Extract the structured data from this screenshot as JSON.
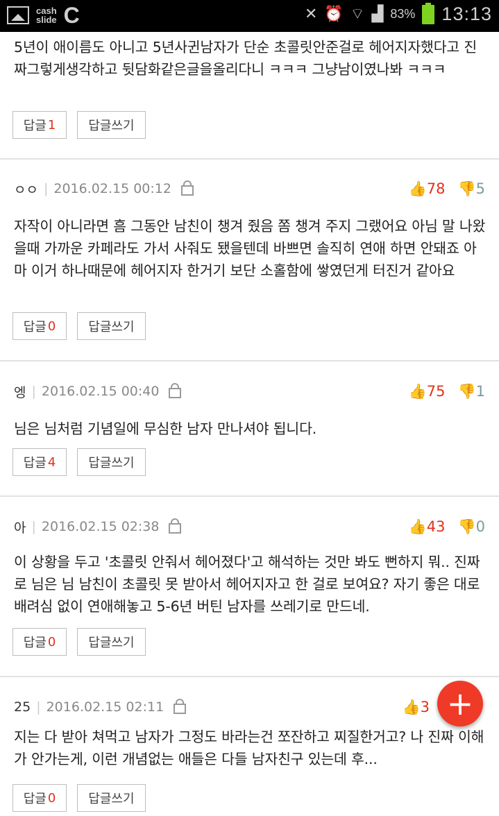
{
  "status_bar": {
    "app_brand_top": "cash",
    "app_brand_bottom": "slide",
    "app_letter": "C",
    "battery_pct": "83%",
    "time": "13:13",
    "icons": [
      "image-icon",
      "mute-icon",
      "alarm-icon",
      "wifi-icon",
      "signal-icon",
      "battery-icon"
    ]
  },
  "comments": [
    {
      "body": "5년이 애이름도 아니고 5년사귄남자가 단순 초콜릿안준걸로 헤어지자했다고 진짜그렇게생각하고 뒷담화같은글을올리다니 ㅋㅋㅋ 그냥남이였나봐 ㅋㅋㅋ",
      "reply_label": "답글",
      "reply_count": "1",
      "write_label": "답글쓰기"
    },
    {
      "author": "ㅇㅇ",
      "date": "2016.02.15 00:12",
      "up": "78",
      "down": "5",
      "body": "자작이 아니라면 흠 그동안 남친이 챙겨 줬음 쫌 챙겨 주지 그랬어요 아님 말 나왔을때 가까운 카페라도 가서 사줘도 됐을텐데 바쁘면 솔직히 연애 하면 안돼죠 아마 이거 하나때문에 헤어지자 한거기 보단 소홀함에 쌓였던게 터진거 같아요",
      "reply_label": "답글",
      "reply_count": "0",
      "write_label": "답글쓰기"
    },
    {
      "author": "엥",
      "date": "2016.02.15 00:40",
      "up": "75",
      "down": "1",
      "body": "님은 님처럼 기념일에 무심한 남자 만나셔야 됩니다.",
      "reply_label": "답글",
      "reply_count": "4",
      "write_label": "답글쓰기"
    },
    {
      "author": "아",
      "date": "2016.02.15 02:38",
      "up": "43",
      "down": "0",
      "body": "이 상황을 두고 '초콜릿 안줘서 헤어졌다'고 해석하는 것만 봐도 뻔하지 뭐.. 진짜로 님은 님 남친이 초콜릿 못 받아서 헤어지자고 한 걸로 보여요? 자기 좋은 대로 배려심 없이 연애해놓고 5-6년 버틴 남자를 쓰레기로 만드네.",
      "reply_label": "답글",
      "reply_count": "0",
      "write_label": "답글쓰기"
    },
    {
      "author": "25",
      "date": "2016.02.15 02:11",
      "up": "3",
      "body": "지는 다 받아 쳐먹고 남자가 그정도 바라는건 쪼잔하고 찌질한거고? 나 진짜 이해가 안가는게, 이런 개념없는 애들은 다들 남자친구 있는데 후...",
      "reply_label": "답글",
      "reply_count": "0",
      "write_label": "답글쓰기"
    }
  ],
  "fab": {
    "icon": "plus-icon",
    "label": "+"
  },
  "colors": {
    "accent": "#e0311b",
    "fab": "#ef3a28",
    "down_vote": "#7a9a9f",
    "battery": "#7ed321"
  }
}
